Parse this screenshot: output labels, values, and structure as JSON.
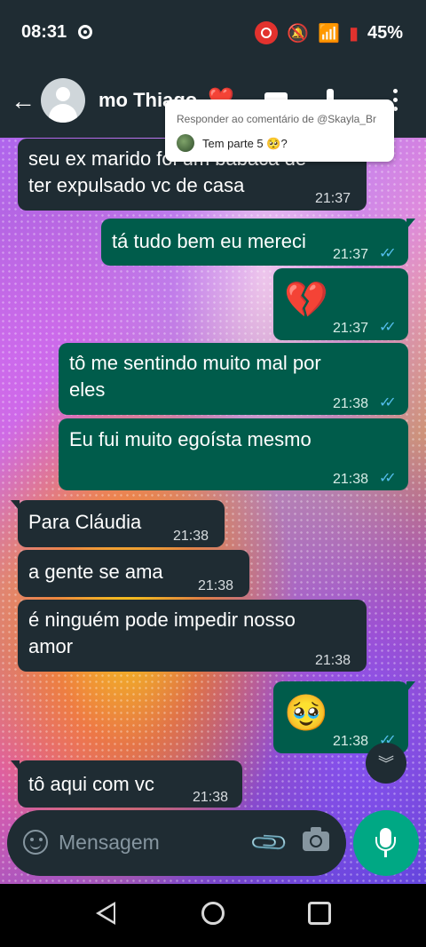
{
  "status_bar": {
    "time": "08:31",
    "battery": "45%"
  },
  "header": {
    "contact_name": "mo Thiago",
    "heart": "❤️"
  },
  "reply_overlay": {
    "title": "Responder ao comentário de @Skayla_Br",
    "text": "Tem parte 5 🥺?"
  },
  "messages": [
    {
      "dir": "in",
      "text_lines": [
        "seu ex marido foi um babaca de",
        "ter expulsado vc de casa"
      ],
      "time": "21:37"
    },
    {
      "dir": "out",
      "text": "tá tudo bem eu mereci",
      "time": "21:37",
      "ticks": "✓✓"
    },
    {
      "dir": "out",
      "emoji": "💔",
      "time": "21:37",
      "ticks": "✓✓"
    },
    {
      "dir": "out",
      "text_lines": [
        "tô me sentindo muito mal por",
        "eles"
      ],
      "time": "21:38",
      "ticks": "✓✓"
    },
    {
      "dir": "out",
      "text": "Eu fui muito egoísta mesmo",
      "time": "21:38",
      "ticks": "✓✓"
    },
    {
      "dir": "in",
      "text": "Para Cláudia",
      "time": "21:38"
    },
    {
      "dir": "in",
      "text": "a gente se ama",
      "time": "21:38"
    },
    {
      "dir": "in",
      "text_lines": [
        "é ninguém pode impedir nosso",
        "amor"
      ],
      "time": "21:38"
    },
    {
      "dir": "out",
      "emoji": "🥹",
      "time": "21:38",
      "ticks": "✓✓"
    },
    {
      "dir": "in",
      "text": "tô aqui com vc",
      "time": "21:38"
    }
  ],
  "input": {
    "placeholder": "Mensagem"
  },
  "colors": {
    "header_bg": "#1f2c33",
    "incoming_bubble": "#1f2c33",
    "outgoing_bubble": "#005c4b",
    "accent": "#00a884",
    "read_ticks": "#53bdeb"
  }
}
